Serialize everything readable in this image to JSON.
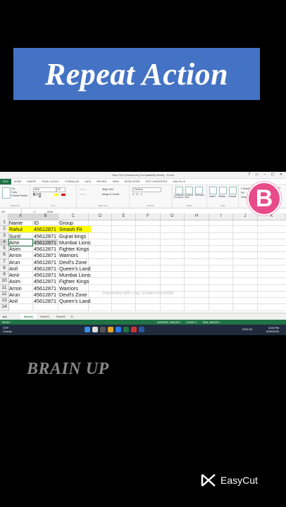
{
  "overlay": {
    "title": "Repeat Action",
    "brand_letter": "B",
    "footer_text": "BRAIN UP",
    "app_logo_text": "EasyCut"
  },
  "window": {
    "title": "New XLS Worksheet [Compatibility Mode] - Excel",
    "controls": "? ▭ – ▢ ✕"
  },
  "ribbon": {
    "tabs": [
      "FILE",
      "HOME",
      "INSERT",
      "PAGE LAYOUT",
      "FORMULAS",
      "DATA",
      "REVIEW",
      "VIEW",
      "DEVELOPER",
      "PDF CONVERTER",
      "Nitro Pro 8"
    ],
    "font_name": "Arial",
    "font_size": "10",
    "number_format": "General",
    "cut": "Cut",
    "copy": "Copy",
    "format_painter": "Format Painter",
    "wrap_text": "Wrap Text",
    "merge_center": "Merge & Center",
    "conditional_formatting": "Conditional Formatting",
    "format_as_table": "Format as Table",
    "cell_styles": "Cell Styles",
    "insert": "Insert",
    "delete": "Delete",
    "format": "Format",
    "autosum": "AutoSum",
    "fill": "Fill",
    "clear": "Clear",
    "sort_filter": "Sort & Filter",
    "find_select": "Find & Select",
    "user": "Joe Rodriguez",
    "groups": [
      "Clipboard",
      "Font",
      "Alignment",
      "Number",
      "Styles",
      "Cells",
      "Editing"
    ]
  },
  "formula_bar": {
    "name_box": "A4",
    "fx": "fx",
    "content": "Amir"
  },
  "sheet": {
    "columns": [
      "A",
      "B",
      "C",
      "D",
      "E",
      "F",
      "G",
      "H",
      "I",
      "J",
      "K"
    ],
    "rows": [
      {
        "num": "1",
        "cells": [
          "Name",
          "ID",
          "Group"
        ]
      },
      {
        "num": "2",
        "cells": [
          "Rahul",
          "45612871",
          "Smash Fit"
        ]
      },
      {
        "num": "3",
        "cells": [
          "Sunil",
          "45612871",
          "Gujrat kings"
        ]
      },
      {
        "num": "4",
        "cells": [
          "Amir",
          "45612871",
          "Mumbai Lions"
        ]
      },
      {
        "num": "5",
        "cells": [
          "Asim",
          "45612871",
          "Fighter Kings"
        ]
      },
      {
        "num": "6",
        "cells": [
          "Arron",
          "45612871",
          "Warriors"
        ]
      },
      {
        "num": "7",
        "cells": [
          "Arun",
          "45612871",
          "Devil's Zone"
        ]
      },
      {
        "num": "8",
        "cells": [
          "Anil",
          "45612871",
          "Queen's Land"
        ]
      },
      {
        "num": "9",
        "cells": [
          "Amir",
          "45612871",
          "Mumbai Lions"
        ]
      },
      {
        "num": "10",
        "cells": [
          "Asim",
          "45612871",
          "Fighter Kings"
        ]
      },
      {
        "num": "11",
        "cells": [
          "Arron",
          "45612871",
          "Warriors"
        ]
      },
      {
        "num": "12",
        "cells": [
          "Arun",
          "45612871",
          "Devil's Zone"
        ]
      },
      {
        "num": "13",
        "cells": [
          "Anil",
          "45612871",
          "Queen's Land"
        ]
      },
      {
        "num": "14",
        "cells": [
          "",
          "",
          ""
        ]
      }
    ],
    "highlight_color": "#ffff00",
    "watermark": "Recorded with iTop Screen Recorder",
    "tabs": [
      "Sheet1",
      "Sheet2",
      "Sheet3"
    ],
    "active_tab": "Sheet1"
  },
  "status_bar": {
    "ready": "READY",
    "average": "AVERAGE: 45612871",
    "count": "COUNT: 2",
    "sum": "SUM: 45612871"
  },
  "taskbar": {
    "temp": "73°F",
    "weather": "Cloudy",
    "lang": "ENG IN",
    "time": "3:59 PM",
    "date": "6/30/2023"
  },
  "colors": {
    "excel_green": "#217346",
    "banner_blue": "#4472c4",
    "brand_pink": "#e84b8a"
  }
}
